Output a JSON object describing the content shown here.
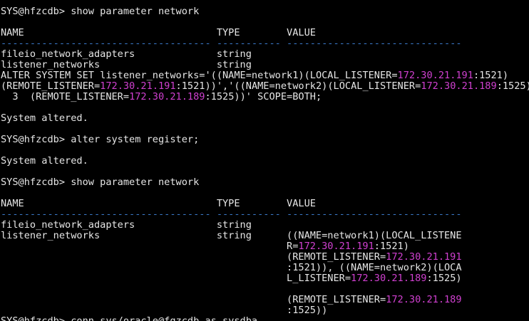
{
  "colors": {
    "background": "#000000",
    "foreground": "#e6e6e6",
    "dashes": "#3a78c8",
    "ip_highlight": "#d040d0"
  },
  "terminal": {
    "lines": [
      {
        "kind": "text",
        "segments": [
          {
            "t": "SYS@hfzcdb> show parameter network"
          }
        ]
      },
      {
        "kind": "blank"
      },
      {
        "kind": "table_header",
        "name": "NAME",
        "type": "TYPE",
        "value": "VALUE"
      },
      {
        "kind": "dash",
        "text": "------------------------------------ ----------- ------------------------------"
      },
      {
        "kind": "row",
        "name": "fileio_network_adapters",
        "type": "string",
        "value": ""
      },
      {
        "kind": "row",
        "name": "listener_networks",
        "type": "string",
        "value": ""
      },
      {
        "kind": "text",
        "segments": [
          {
            "t": "ALTER SYSTEM SET listener_networks='((NAME=network1)(LOCAL_LISTENER="
          },
          {
            "t": "172.30.21.191",
            "ip": true
          },
          {
            "t": ":1521)"
          }
        ]
      },
      {
        "kind": "text",
        "segments": [
          {
            "t": "(REMOTE_LISTENER="
          },
          {
            "t": "172.30.21.191",
            "ip": true
          },
          {
            "t": ":1521))','((NAME=network2)(LOCAL_LISTENER="
          },
          {
            "t": "172.30.21.189",
            "ip": true
          },
          {
            "t": ":1525)"
          }
        ]
      },
      {
        "kind": "text",
        "segments": [
          {
            "t": "  3  (REMOTE_LISTENER="
          },
          {
            "t": "172.30.21.189",
            "ip": true
          },
          {
            "t": ":1525))' SCOPE=BOTH;"
          }
        ]
      },
      {
        "kind": "blank"
      },
      {
        "kind": "text",
        "segments": [
          {
            "t": "System altered."
          }
        ]
      },
      {
        "kind": "blank"
      },
      {
        "kind": "text",
        "segments": [
          {
            "t": "SYS@hfzcdb> alter system register;"
          }
        ]
      },
      {
        "kind": "blank"
      },
      {
        "kind": "text",
        "segments": [
          {
            "t": "System altered."
          }
        ]
      },
      {
        "kind": "blank"
      },
      {
        "kind": "text",
        "segments": [
          {
            "t": "SYS@hfzcdb> show parameter network"
          }
        ]
      },
      {
        "kind": "blank"
      },
      {
        "kind": "table_header",
        "name": "NAME",
        "type": "TYPE",
        "value": "VALUE"
      },
      {
        "kind": "dash",
        "text": "------------------------------------ ----------- ------------------------------"
      },
      {
        "kind": "row",
        "name": "fileio_network_adapters",
        "type": "string",
        "value": ""
      },
      {
        "kind": "row",
        "name": "listener_networks",
        "type": "string",
        "value_segments": [
          {
            "t": "((NAME=network1)(LOCAL_LISTENE"
          }
        ]
      },
      {
        "kind": "row",
        "name": "",
        "type": "",
        "value_segments": [
          {
            "t": "R="
          },
          {
            "t": "172.30.21.191",
            "ip": true
          },
          {
            "t": ":1521)"
          }
        ]
      },
      {
        "kind": "row",
        "name": "",
        "type": "",
        "value_segments": [
          {
            "t": "(REMOTE_LISTENER="
          },
          {
            "t": "172.30.21.191",
            "ip": true
          }
        ]
      },
      {
        "kind": "row",
        "name": "",
        "type": "",
        "value_segments": [
          {
            "t": ":1521)), ((NAME=network2)(LOCA"
          }
        ]
      },
      {
        "kind": "row",
        "name": "",
        "type": "",
        "value_segments": [
          {
            "t": "L_LISTENER="
          },
          {
            "t": "172.30.21.189",
            "ip": true
          },
          {
            "t": ":1525)"
          }
        ]
      },
      {
        "kind": "blank"
      },
      {
        "kind": "row",
        "name": "",
        "type": "",
        "value_segments": [
          {
            "t": "(REMOTE_LISTENER="
          },
          {
            "t": "172.30.21.189",
            "ip": true
          }
        ]
      },
      {
        "kind": "row",
        "name": "",
        "type": "",
        "value_segments": [
          {
            "t": ":1525))"
          }
        ]
      },
      {
        "kind": "text",
        "segments": [
          {
            "t": "SYS@hfzcdb> conn sys/oracle@fgzcdb as sysdba"
          }
        ]
      }
    ]
  }
}
